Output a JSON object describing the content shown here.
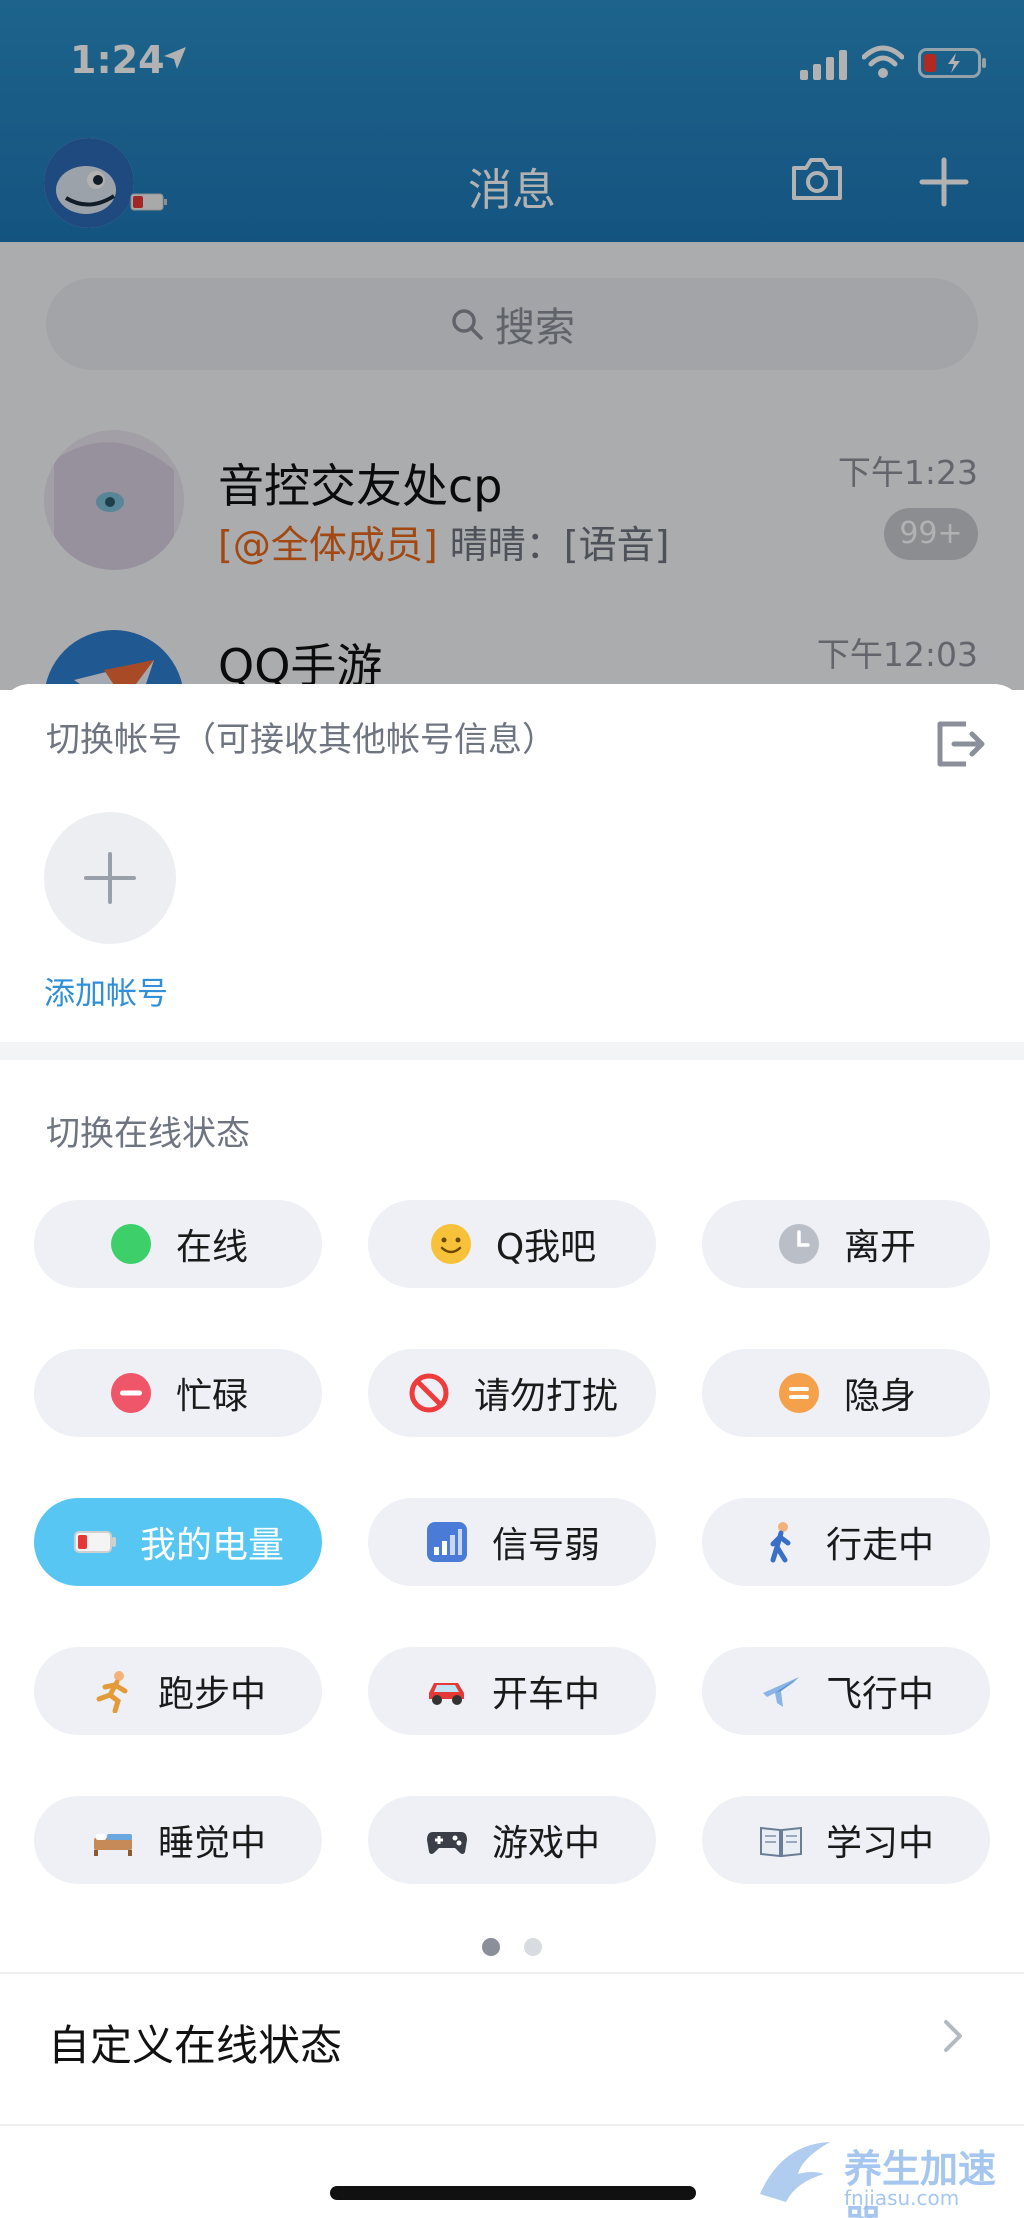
{
  "status_bar": {
    "time": "1:24"
  },
  "header": {
    "title": "消息"
  },
  "search": {
    "placeholder": "搜索"
  },
  "conversations": [
    {
      "name": "音控交友处cp",
      "time": "下午1:23",
      "mention": "[@全体成员]",
      "preview": "晴晴：[语音]",
      "badge": "99+"
    },
    {
      "name": "QQ手游",
      "time": "下午12:03"
    }
  ],
  "sheet": {
    "switch_account_title": "切换帐号（可接收其他帐号信息）",
    "add_account_label": "添加帐号",
    "switch_status_title": "切换在线状态",
    "custom_status_label": "自定义在线状态",
    "active_status": "我的电量",
    "page_indicator": {
      "current": 1,
      "total": 2
    }
  },
  "statuses": [
    {
      "label": "在线",
      "icon": "online-dot-icon"
    },
    {
      "label": "Q我吧",
      "icon": "smile-face-icon"
    },
    {
      "label": "离开",
      "icon": "clock-icon"
    },
    {
      "label": "忙碌",
      "icon": "busy-minus-icon"
    },
    {
      "label": "请勿打扰",
      "icon": "no-entry-icon"
    },
    {
      "label": "隐身",
      "icon": "hidden-equals-icon"
    },
    {
      "label": "我的电量",
      "icon": "battery-icon"
    },
    {
      "label": "信号弱",
      "icon": "signal-bars-icon"
    },
    {
      "label": "行走中",
      "icon": "walking-person-icon"
    },
    {
      "label": "跑步中",
      "icon": "running-person-icon"
    },
    {
      "label": "开车中",
      "icon": "car-icon"
    },
    {
      "label": "飞行中",
      "icon": "airplane-icon"
    },
    {
      "label": "睡觉中",
      "icon": "bed-icon"
    },
    {
      "label": "游戏中",
      "icon": "game-controller-icon"
    },
    {
      "label": "学习中",
      "icon": "open-book-icon"
    }
  ],
  "watermark": {
    "text": "养生加速器",
    "url": "fnjiasu.com"
  },
  "colors": {
    "header": "#1e78b8",
    "active_pill": "#58c6f2",
    "pill": "#eef0f5",
    "link": "#2f8fd8",
    "mention": "#e8681c"
  }
}
